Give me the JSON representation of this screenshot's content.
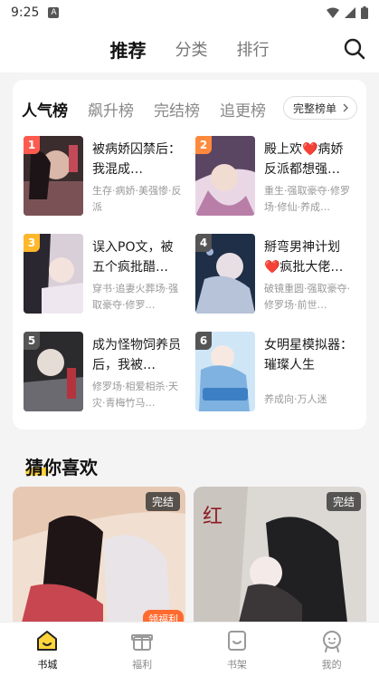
{
  "status_bar": {
    "time": "9:25",
    "notif_letter": "A"
  },
  "top_tabs": [
    {
      "label": "推荐",
      "active": true
    },
    {
      "label": "分类",
      "active": false
    },
    {
      "label": "排行",
      "active": false
    }
  ],
  "rank": {
    "tabs": [
      "人气榜",
      "飙升榜",
      "完结榜",
      "追更榜"
    ],
    "full_list_label": "完整榜单",
    "books": [
      {
        "rank": "1",
        "title": "被病娇囚禁后：我混成…",
        "tags": "生存·病娇·美强惨·反派",
        "rank_color": "#ff5a4f"
      },
      {
        "rank": "2",
        "title": "殿上欢❤️病娇反派都想强…",
        "tags": "重生·强取豪夺·修罗场·修仙·养成…",
        "rank_color": "#ff8a3d"
      },
      {
        "rank": "3",
        "title": "误入PO文，被五个疯批醋…",
        "tags": "穿书·追妻火葬场·强取豪夺·修罗…",
        "rank_color": "#ffb72b"
      },
      {
        "rank": "4",
        "title": "掰弯男神计划❤️疯批大佬…",
        "tags": "破镜重圆·强取豪夺·修罗场·前世…",
        "rank_color": "#555555"
      },
      {
        "rank": "5",
        "title": "成为怪物饲养员后，我被…",
        "tags": "修罗场·相爱相杀·天灾·青梅竹马…",
        "rank_color": "#555555"
      },
      {
        "rank": "6",
        "title": "女明星模拟器：璀璨人生",
        "tags": "养成向·万人迷",
        "rank_color": "#555555"
      }
    ]
  },
  "guess": {
    "title": "猜你喜欢",
    "cards": [
      {
        "badge": "完结"
      },
      {
        "badge": "完结"
      }
    ]
  },
  "bottom_nav": {
    "items": [
      {
        "label": "书城",
        "icon": "home-icon",
        "active": true
      },
      {
        "label": "福利",
        "icon": "gift-icon",
        "active": false
      },
      {
        "label": "书架",
        "icon": "bookshelf-icon",
        "active": false
      },
      {
        "label": "我的",
        "icon": "profile-icon",
        "active": false
      }
    ],
    "welfare_badge": "领福利"
  },
  "colors": {
    "accent": "#ffd43b",
    "badge": "#ff6a2f"
  }
}
